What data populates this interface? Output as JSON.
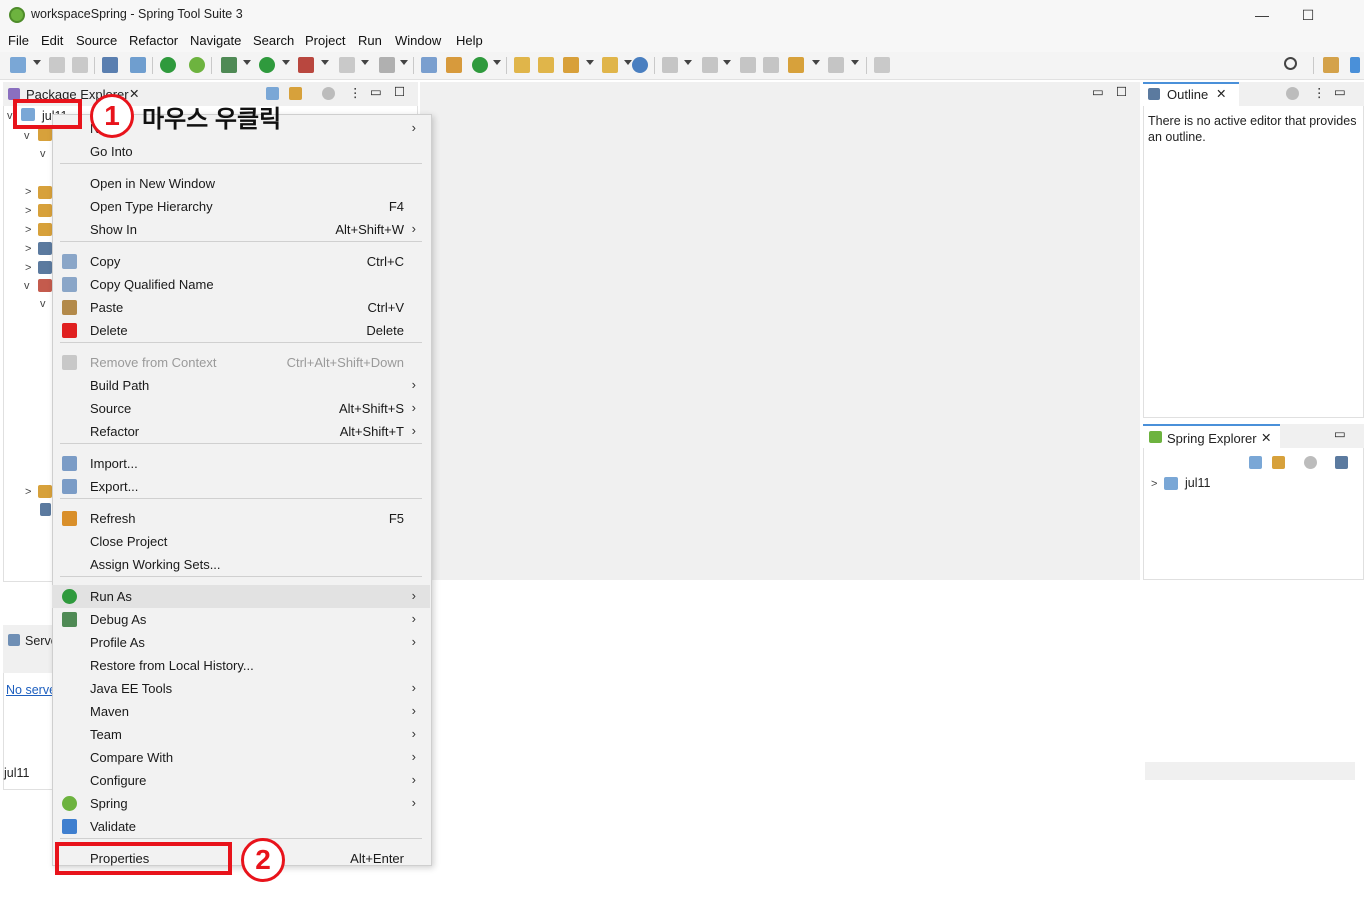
{
  "window": {
    "title": "workspaceSpring - Spring Tool Suite 3",
    "minimize": "—",
    "maximize": "☐"
  },
  "menubar": [
    "File",
    "Edit",
    "Source",
    "Refactor",
    "Navigate",
    "Search",
    "Project",
    "Run",
    "Window",
    "Help"
  ],
  "package_explorer": {
    "tab_label": "Package Explorer",
    "project_label": "jul11"
  },
  "editor": {},
  "outline": {
    "tab_label": "Outline",
    "message": "There is no active editor that provides an outline."
  },
  "spring_explorer": {
    "tab_label": "Spring Explorer",
    "project_label": "jul11"
  },
  "servers": {
    "tab_label": "Servers",
    "link_text": "No servers",
    "status_label": "jul11"
  },
  "context_menu": {
    "items": [
      {
        "label": "New",
        "accel": "",
        "submenu": true,
        "icon": ""
      },
      {
        "label": "Go Into",
        "accel": "",
        "submenu": false,
        "icon": ""
      },
      {
        "label": "Open in New Window",
        "accel": "",
        "submenu": false,
        "icon": ""
      },
      {
        "label": "Open Type Hierarchy",
        "accel": "F4",
        "submenu": false,
        "icon": ""
      },
      {
        "label": "Show In",
        "accel": "Alt+Shift+W",
        "submenu": true,
        "icon": ""
      },
      {
        "label": "Copy",
        "accel": "Ctrl+C",
        "submenu": false,
        "icon": "copy-icon"
      },
      {
        "label": "Copy Qualified Name",
        "accel": "",
        "submenu": false,
        "icon": "copy-qualified-icon"
      },
      {
        "label": "Paste",
        "accel": "Ctrl+V",
        "submenu": false,
        "icon": "paste-icon"
      },
      {
        "label": "Delete",
        "accel": "Delete",
        "submenu": false,
        "icon": "delete-icon"
      },
      {
        "label": "Remove from Context",
        "accel": "Ctrl+Alt+Shift+Down",
        "submenu": false,
        "icon": "remove-context-icon",
        "disabled": true
      },
      {
        "label": "Build Path",
        "accel": "",
        "submenu": true,
        "icon": ""
      },
      {
        "label": "Source",
        "accel": "Alt+Shift+S",
        "submenu": true,
        "icon": ""
      },
      {
        "label": "Refactor",
        "accel": "Alt+Shift+T",
        "submenu": true,
        "icon": ""
      },
      {
        "label": "Import...",
        "accel": "",
        "submenu": false,
        "icon": "import-icon"
      },
      {
        "label": "Export...",
        "accel": "",
        "submenu": false,
        "icon": "export-icon"
      },
      {
        "label": "Refresh",
        "accel": "F5",
        "submenu": false,
        "icon": "refresh-icon"
      },
      {
        "label": "Close Project",
        "accel": "",
        "submenu": false,
        "icon": ""
      },
      {
        "label": "Assign Working Sets...",
        "accel": "",
        "submenu": false,
        "icon": ""
      },
      {
        "label": "Run As",
        "accel": "",
        "submenu": true,
        "icon": "run-icon",
        "highlighted": true
      },
      {
        "label": "Debug As",
        "accel": "",
        "submenu": true,
        "icon": "debug-icon"
      },
      {
        "label": "Profile As",
        "accel": "",
        "submenu": true,
        "icon": ""
      },
      {
        "label": "Restore from Local History...",
        "accel": "",
        "submenu": false,
        "icon": ""
      },
      {
        "label": "Java EE Tools",
        "accel": "",
        "submenu": true,
        "icon": ""
      },
      {
        "label": "Maven",
        "accel": "",
        "submenu": true,
        "icon": ""
      },
      {
        "label": "Team",
        "accel": "",
        "submenu": true,
        "icon": ""
      },
      {
        "label": "Compare With",
        "accel": "",
        "submenu": true,
        "icon": ""
      },
      {
        "label": "Configure",
        "accel": "",
        "submenu": true,
        "icon": ""
      },
      {
        "label": "Spring",
        "accel": "",
        "submenu": true,
        "icon": "spring-icon"
      },
      {
        "label": "Validate",
        "accel": "",
        "submenu": false,
        "icon": "validate-icon"
      },
      {
        "label": "Properties",
        "accel": "Alt+Enter",
        "submenu": false,
        "icon": ""
      }
    ]
  },
  "annotations": {
    "step1_number": "1",
    "step1_text": "마우스 우클릭",
    "step2_number": "2"
  },
  "colors": {
    "annotation_red": "#e8131b",
    "spring_green": "#6db33f",
    "menu_bg": "#f2f2f2",
    "highlight": "#e2e2e2"
  }
}
